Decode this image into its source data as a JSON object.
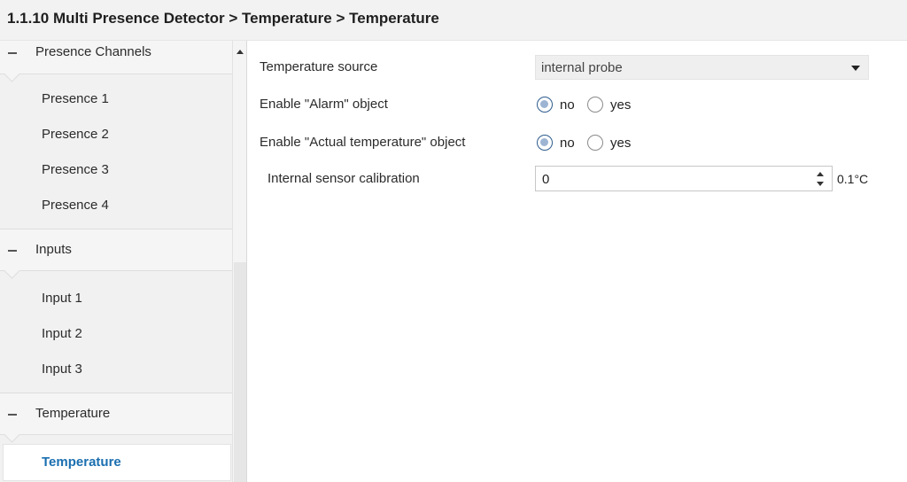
{
  "header": {
    "breadcrumb": "1.1.10 Multi Presence Detector > Temperature > Temperature"
  },
  "sidebar": {
    "groups": [
      {
        "label": "Presence Channels",
        "items": [
          "Presence 1",
          "Presence 2",
          "Presence 3",
          "Presence 4"
        ]
      },
      {
        "label": "Inputs",
        "items": [
          "Input 1",
          "Input 2",
          "Input 3"
        ]
      },
      {
        "label": "Temperature",
        "items": [
          "Temperature"
        ]
      }
    ],
    "active_item": "Temperature"
  },
  "params": {
    "temperature_source": {
      "label": "Temperature source",
      "value": "internal probe"
    },
    "alarm": {
      "label": "Enable \"Alarm\" object",
      "selected": "no",
      "opt_no": "no",
      "opt_yes": "yes"
    },
    "actual_temp": {
      "label": "Enable \"Actual temperature\" object",
      "selected": "no",
      "opt_no": "no",
      "opt_yes": "yes"
    },
    "calibration": {
      "label": "Internal sensor calibration",
      "value": "0",
      "unit": "0.1°C"
    }
  },
  "colors": {
    "accent": "#1a6fb0",
    "sidebar_bg": "#f1f1f1",
    "header_bg": "#f2f2f2",
    "radio_checked": "#2d5c8e"
  }
}
